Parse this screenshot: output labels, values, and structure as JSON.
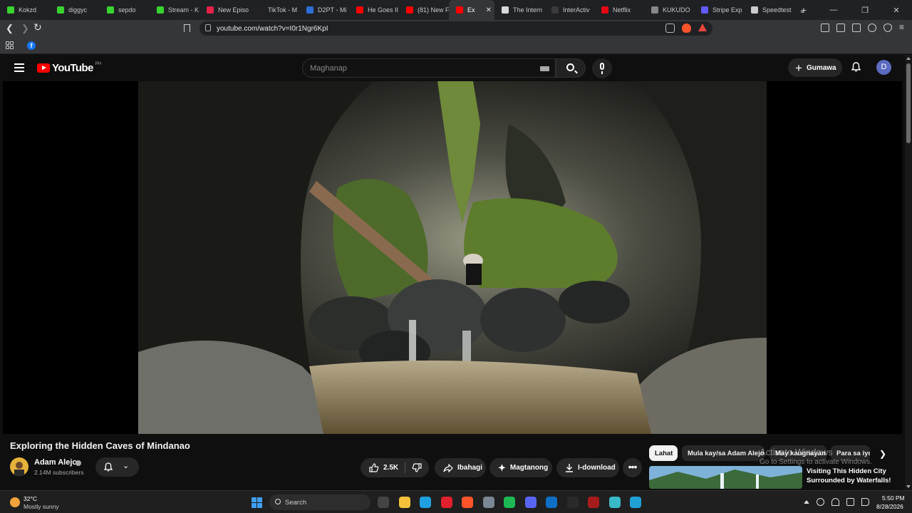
{
  "browser": {
    "tabs": [
      {
        "label": "Kokzd",
        "color": "#38d430"
      },
      {
        "label": "diggyc",
        "color": "#38d430"
      },
      {
        "label": "sepdo",
        "color": "#38d430"
      },
      {
        "label": "Stream - K",
        "color": "#38d430"
      },
      {
        "label": "New Episo",
        "color": "#e5224a"
      },
      {
        "label": "TikTok - M",
        "color": "#222222"
      },
      {
        "label": "D2PT - Mi",
        "color": "#2c6fd6"
      },
      {
        "label": "He Goes II",
        "color": "#ff0000"
      },
      {
        "label": "(81) New F",
        "color": "#ff0000"
      },
      {
        "label": "Ex",
        "color": "#ff0000",
        "active": true
      },
      {
        "label": "The Intern",
        "color": "#d8d8d8"
      },
      {
        "label": "InterActiv",
        "color": "#3a3a3a"
      },
      {
        "label": "Netflix",
        "color": "#e50914"
      },
      {
        "label": "KUKUDO",
        "color": "#888888"
      },
      {
        "label": "Stripe Exp",
        "color": "#635bff"
      },
      {
        "label": "Speedtest",
        "color": "#cccccc"
      }
    ],
    "new_tab": "+",
    "url": "youtube.com/watch?v=I0r1Ngr6KpI"
  },
  "yt": {
    "logo_text": "YouTube",
    "region": "PH",
    "search_placeholder": "Maghanap",
    "create_label": "Gumawa",
    "avatar_letter": "D"
  },
  "video": {
    "title": "Exploring the Hidden Caves of Mindanao",
    "channel": "Adam Alejo",
    "subscribers": "2.14M subscribers",
    "likes": "2.5K",
    "share_label": "Ibahagi",
    "ask_label": "Magtanong",
    "download_label": "I-download"
  },
  "chips": [
    "Lahat",
    "Mula kay/sa Adam Alejo",
    "May kaugnayan",
    "Para sa iyo"
  ],
  "recommended": {
    "title": "Visiting This Hidden City Surrounded by Waterfalls!"
  },
  "watermark": {
    "line1": "Activate Windows",
    "line2": "Go to Settings to activate Windows."
  },
  "taskbar": {
    "temp": "32°C",
    "weather": "Mostly sunny",
    "search_label": "Search",
    "time": "5:50 PM",
    "date": "8/28/2026",
    "apps": [
      {
        "name": "task-view-icon",
        "color": "#444"
      },
      {
        "name": "file-explorer-icon",
        "color": "#f5c13b"
      },
      {
        "name": "edge-icon",
        "color": "#1fa0e0"
      },
      {
        "name": "opera-icon",
        "color": "#e0202c"
      },
      {
        "name": "brave-icon",
        "color": "#fb542b"
      },
      {
        "name": "settings-icon",
        "color": "#7a8794"
      },
      {
        "name": "spotify-icon",
        "color": "#1db954"
      },
      {
        "name": "discord-icon",
        "color": "#5865f2"
      },
      {
        "name": "vscode-icon",
        "color": "#0f6fc6"
      },
      {
        "name": "steam-icon",
        "color": "#2a2a2a"
      },
      {
        "name": "dota-icon",
        "color": "#a61c1c"
      },
      {
        "name": "notepad-icon",
        "color": "#3ab9c8"
      },
      {
        "name": "chrome-icon",
        "color": "#21a0d6"
      }
    ]
  }
}
